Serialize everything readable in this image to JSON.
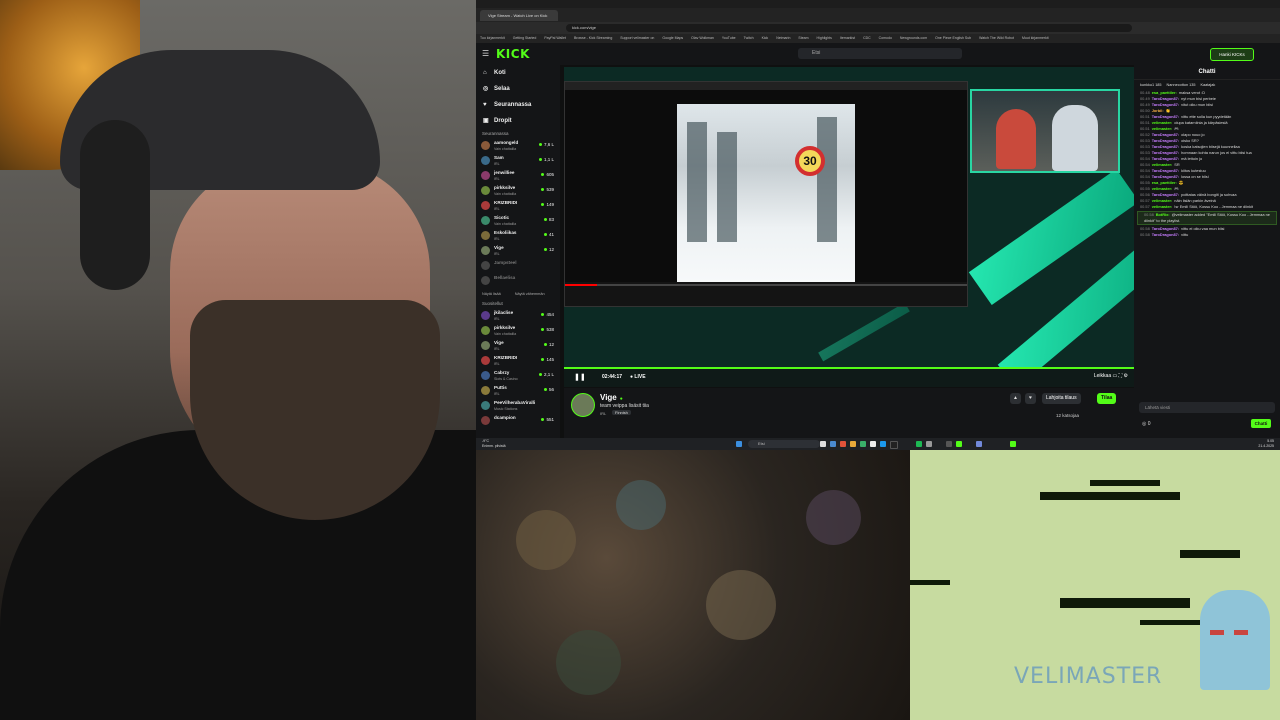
{
  "browser": {
    "tab_title": "Vige Stream - Watch Live on Kick",
    "url": "kick.com/vige",
    "bookmarks": [
      "Tuo kirjanmerkit",
      "Getting Started",
      "PayPal Wallet",
      "Browse - Kick Streaming",
      "Support velimaster on",
      "Google Maps",
      "Olav Wolkman",
      "YouTube",
      "Twitch",
      "Kick",
      "Netmarin",
      "Steam",
      "Highlights",
      "Itemarkist",
      "CDC",
      "Comodo",
      "Newgrounds.com",
      "One Piece English Sub",
      "Watch The Wild Robot",
      "Muut kirjanmerkit"
    ]
  },
  "kick": {
    "logo": "KICK",
    "search_placeholder": "Etsi",
    "login_label": "Hanki KICKs",
    "nav": [
      {
        "label": "Koti",
        "icon": "home-icon"
      },
      {
        "label": "Selaa",
        "icon": "compass-icon"
      },
      {
        "label": "Seurannassa",
        "icon": "heart-icon"
      },
      {
        "label": "Dropit",
        "icon": "gift-icon"
      }
    ],
    "following_title": "Seurannassa",
    "following": [
      {
        "name": "aamongeld",
        "sub": "Vain chattailla",
        "viewers": "7,6 L",
        "color": "#8a5a3a",
        "online": true
      },
      {
        "name": "Sam",
        "sub": "IRL",
        "viewers": "1,1 L",
        "color": "#3a6a8a",
        "online": true
      },
      {
        "name": "jenwilliee",
        "sub": "IRL",
        "viewers": "605",
        "color": "#8a3a6a",
        "online": true
      },
      {
        "name": "pirkksilve",
        "sub": "Vain chattailla",
        "viewers": "539",
        "color": "#6a8a3a",
        "online": true
      },
      {
        "name": "KRIZBRIDI",
        "sub": "IRL",
        "viewers": "149",
        "color": "#aa3a3a",
        "online": true
      },
      {
        "name": "Sicotic",
        "sub": "Vain chattailla",
        "viewers": "83",
        "color": "#3a8a6a",
        "online": true
      },
      {
        "name": "Eskoliikas",
        "sub": "IRL",
        "viewers": "41",
        "color": "#7a6a3a",
        "online": true
      },
      {
        "name": "Vige",
        "sub": "IRL",
        "viewers": "12",
        "color": "#6b7a58",
        "online": true
      },
      {
        "name": "Jampsteel",
        "sub": "",
        "viewers": "",
        "color": "#444",
        "online": false
      },
      {
        "name": "Bellaelisa",
        "sub": "",
        "viewers": "",
        "color": "#444",
        "online": false
      }
    ],
    "show_more": "Näytä lisää",
    "show_less": "Näytä vähemmän",
    "recommended_title": "Suositellut",
    "recommended": [
      {
        "name": "jkilaclise",
        "sub": "IRL",
        "viewers": "454",
        "color": "#5a3a8a"
      },
      {
        "name": "pirkksilve",
        "sub": "Vain chattailla",
        "viewers": "538",
        "color": "#6a8a3a"
      },
      {
        "name": "Vige",
        "sub": "IRL",
        "viewers": "12",
        "color": "#6b7a58"
      },
      {
        "name": "KRIZBRIDI",
        "sub": "IRL",
        "viewers": "145",
        "color": "#aa3a3a"
      },
      {
        "name": "Cabrzy",
        "sub": "Slots & Casino",
        "viewers": "2,1 L",
        "color": "#3a5a8a"
      },
      {
        "name": "Puttis",
        "sub": "IRL",
        "viewers": "56",
        "color": "#8a7a3a"
      },
      {
        "name": "PeeVilherabaViralli",
        "sub": "Music Stations",
        "viewers": "",
        "color": "#3a7a7a"
      },
      {
        "name": "dcampion",
        "sub": "",
        "viewers": "551",
        "color": "#7a3a3a"
      }
    ],
    "stream": {
      "time": "02:44:17",
      "live": "LIVE",
      "channel": "Vige",
      "title": "team veippa lisäsit tiia",
      "category": "IRL",
      "tag": "Finnish",
      "gift_label": "Lahjoita tilaus",
      "follow_label": "Tilaa",
      "viewers": "12 katsojaa",
      "clip_label": "Leikkaa",
      "sign_number": "30"
    },
    "chat": {
      "title": "Chatti",
      "pinned": [
        "kunkku1 185",
        "Nannecotton 135",
        "Kaatajak"
      ],
      "messages": [
        {
          "t": "00.48",
          "u": "esa_paettiler:",
          "m": "maksa verot :D",
          "c": "#53fc18"
        },
        {
          "t": "00.49",
          "u": "TaroDragon87:",
          "m": "nyt mun bisi perbeie",
          "c": "#c77dff"
        },
        {
          "t": "00.49",
          "u": "TaroDragon87:",
          "m": "vitut oiku mun biisi",
          "c": "#c77dff"
        },
        {
          "t": "00.50",
          "u": "Jorbil:",
          "m": "👏",
          "c": "#ffb347"
        },
        {
          "t": "00.51",
          "u": "TaroDragon87:",
          "m": "vittu ette solla kun pyydetään",
          "c": "#c77dff"
        },
        {
          "t": "00.51",
          "u": "velimaster:",
          "m": "olupa katarniinia ja kärpäsiesiä",
          "c": "#53fc18"
        },
        {
          "t": "00.51",
          "u": "velimaster:",
          "m": "🎮",
          "c": "#53fc18"
        },
        {
          "t": "00.52",
          "u": "TaroDragon87:",
          "m": "olapo nouo jo",
          "c": "#c77dff"
        },
        {
          "t": "00.53",
          "u": "TaroDragon87:",
          "m": "oisko SR?",
          "c": "#c77dff"
        },
        {
          "t": "00.53",
          "u": "TaroDragon87:",
          "m": "koska katsojien biisejä kuunnellaa",
          "c": "#c77dff"
        },
        {
          "t": "00.53",
          "u": "TaroDragon87:",
          "m": "homnaan kohta narun jos ei vittu biisi tua",
          "c": "#c77dff"
        },
        {
          "t": "00.54",
          "u": "TaroDragon87:",
          "m": "mä lettoin jo",
          "c": "#c77dff"
        },
        {
          "t": "00.54",
          "u": "velimaster:",
          "m": "SR",
          "c": "#53fc18"
        },
        {
          "t": "00.54",
          "u": "TaroDragon87:",
          "m": "kiitos kutestuu",
          "c": "#c77dff"
        },
        {
          "t": "00.54",
          "u": "TaroDragon87:",
          "m": "lossa on se biisi",
          "c": "#c77dff"
        },
        {
          "t": "00.55",
          "u": "esa_paettiler:",
          "m": "😎",
          "c": "#53fc18"
        },
        {
          "t": "00.55",
          "u": "velimaster:",
          "m": "🎮",
          "c": "#53fc18"
        },
        {
          "t": "00.56",
          "u": "TaroDragon87:",
          "m": "poittatas väinä bongiti ja sohvaa",
          "c": "#c77dff"
        },
        {
          "t": "00.57",
          "u": "velimaster:",
          "m": "näin lisiän parkin äveinä",
          "c": "#53fc18"
        },
        {
          "t": "00.57",
          "u": "velimaster:",
          "m": "!sr Emili Stöö, Kossu Koo - Jemmaa ne diinkit",
          "c": "#53fc18"
        }
      ],
      "bot_message": {
        "t": "00.58",
        "u": "BotRix:",
        "m": "@velimaster added \"Emili Stöö, Kossu Koo - Jemmaa ne diinkit\" to the playlist.",
        "c": "#53fc18"
      },
      "after": [
        {
          "t": "00.58",
          "u": "TaroDragon87:",
          "m": "vittu ei oiku vaa mun biisi",
          "c": "#c77dff"
        },
        {
          "t": "00.58",
          "u": "TaroDragon87:",
          "m": "vittu",
          "c": "#c77dff"
        }
      ],
      "input_placeholder": "Lähetä viesti",
      "points": "0",
      "send_label": "Chatti"
    }
  },
  "taskbar": {
    "weather_temp": "-9°C",
    "weather_text": "Enimm. pilvistä",
    "search_placeholder": "Etsi",
    "time": "5.05",
    "date": "21.4.2025"
  },
  "overlay": {
    "watermark": "VELIMASTER"
  }
}
